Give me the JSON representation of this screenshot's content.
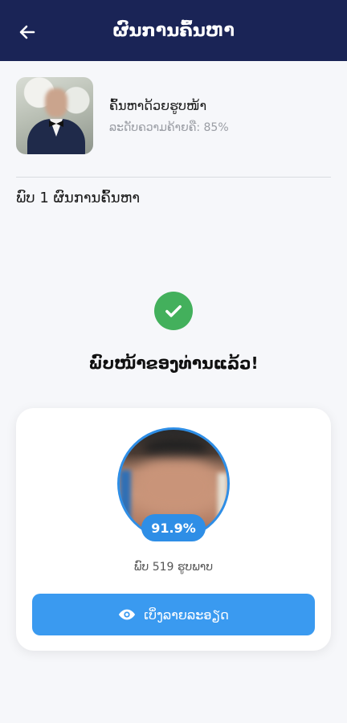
{
  "appbar": {
    "title": "ຜົນການຄົ້ນຫາ"
  },
  "query": {
    "title": "ຄົ້ນຫາດ້ວຍຮູບໜ້າ",
    "similarity": "ລະດັບຄວາມຄ້າຍຄື: 85%"
  },
  "results": {
    "count_text": "ພົບ 1 ຜົນການຄົ້ນຫາ"
  },
  "status": {
    "found_text": "ພົບໜ້າຂອງທ່ານແລ້ວ!"
  },
  "match": {
    "score": "91.9%",
    "photos_found": "ພົບ 519 ຮູບພາບ",
    "view_button": "ເບິ່ງລາຍລະອຽດ"
  },
  "colors": {
    "appbar": "#1a2456",
    "success": "#43b05c",
    "accent": "#3a9af0"
  },
  "icons": {
    "back": "arrow-left-icon",
    "check": "check-circle-icon",
    "view": "eye-icon"
  }
}
